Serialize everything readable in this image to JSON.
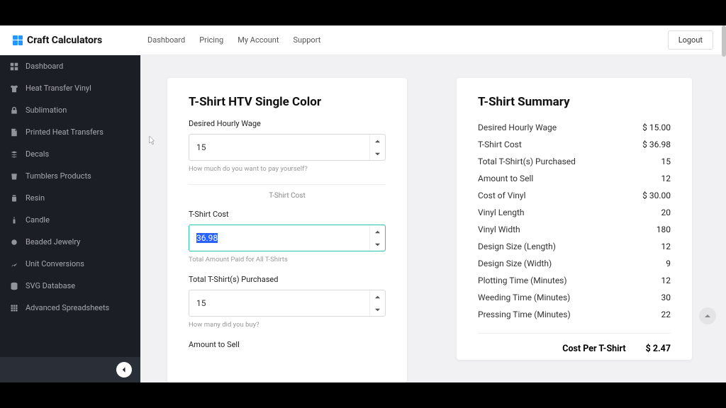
{
  "brand": "Craft Calculators",
  "topnav": [
    "Dashboard",
    "Pricing",
    "My Account",
    "Support"
  ],
  "logout": "Logout",
  "sidebar": {
    "items": [
      {
        "label": "Dashboard",
        "icon": "dashboard"
      },
      {
        "label": "Heat Transfer Vinyl",
        "icon": "shirt"
      },
      {
        "label": "Sublimation",
        "icon": "lock"
      },
      {
        "label": "Printed Heat Transfers",
        "icon": "doc"
      },
      {
        "label": "Decals",
        "icon": "stack"
      },
      {
        "label": "Tumblers Products",
        "icon": "cup"
      },
      {
        "label": "Resin",
        "icon": "jar"
      },
      {
        "label": "Candle",
        "icon": "candle"
      },
      {
        "label": "Beaded Jewelry",
        "icon": "bead"
      },
      {
        "label": "Unit Conversions",
        "icon": "graph"
      },
      {
        "label": "SVG Database",
        "icon": "db"
      },
      {
        "label": "Advanced Spreadsheets",
        "icon": "sheet"
      }
    ]
  },
  "form": {
    "title": "T-Shirt HTV Single Color",
    "wage_label": "Desired Hourly Wage",
    "wage_value": "15",
    "wage_hint": "How much do you want to pay yourself?",
    "section_sub": "T-Shirt Cost",
    "cost_label": "T-Shirt Cost",
    "cost_value": "36.98",
    "cost_hint": "Total Amount Paid for All T-Shirts",
    "purchased_label": "Total T-Shirt(s) Purchased",
    "purchased_value": "15",
    "purchased_hint": "How many did you buy?",
    "amount_sell_label": "Amount to Sell"
  },
  "summary": {
    "title": "T-Shirt Summary",
    "rows": [
      {
        "label": "Desired Hourly Wage",
        "value": "$ 15.00"
      },
      {
        "label": "T-Shirt Cost",
        "value": "$ 36.98"
      },
      {
        "label": "Total T-Shirt(s) Purchased",
        "value": "15"
      },
      {
        "label": "Amount to Sell",
        "value": "12"
      },
      {
        "label": "Cost of Vinyl",
        "value": "$ 30.00"
      },
      {
        "label": "Vinyl Length",
        "value": "20"
      },
      {
        "label": "Vinyl Width",
        "value": "180"
      },
      {
        "label": "Design Size (Length)",
        "value": "12"
      },
      {
        "label": "Design Size (Width)",
        "value": "9"
      },
      {
        "label": "Plotting Time (Minutes)",
        "value": "12"
      },
      {
        "label": "Weeding Time (Minutes)",
        "value": "30"
      },
      {
        "label": "Pressing Time (Minutes)",
        "value": "22"
      }
    ],
    "foot_label": "Cost Per T-Shirt",
    "foot_value": "$ 2.47"
  }
}
